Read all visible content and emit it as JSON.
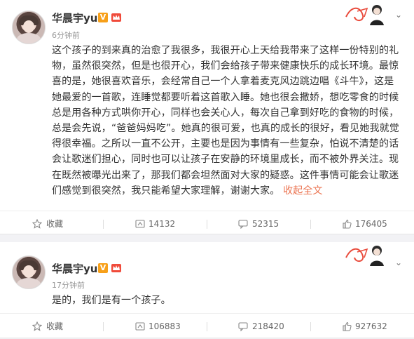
{
  "posts": [
    {
      "author": "华晨宇yu",
      "time": "6分钟前",
      "paragraph": "这个孩子的到来真的治愈了我很多，我很开心上天给我带来了这样一份特别的礼物，虽然很突然，但是也很开心，我们会给孩子带来健康快乐的成长环境。最惊喜的是，她很喜欢音乐，会经常自己一个人拿着麦克风边跳边唱《斗牛》，这是她最爱的一首歌，连睡觉都要听着这首歌入睡。她也很会撒娇，想吃零食的时候总是用各种方式哄你开心，同样也会关心人，每次自己拿到好吃的食物的时候，总是会先说，“爸爸妈妈吃”。她真的很可爱，也真的成长的很好，看见她我就觉得很幸福。之所以一直不公开，主要也是因为事情有一些复杂，怕说不清楚的话会让歌迷们担心，同时也可以让孩子在安静的环境里成长，而不被外界关注。现在既然被曝光出来了，那我们都会坦然面对大家的疑惑。这件事情可能会让歌迷们感觉到很突然，我只能希望大家理解，谢谢大家。",
      "collapse": "收起全文",
      "collect": "收藏",
      "repost": "14132",
      "comment": "52315",
      "like": "176405"
    },
    {
      "author": "华晨宇yu",
      "time": "17分钟前",
      "paragraph": "是的，我们是有一个孩子。",
      "collect": "收藏",
      "repost": "106883",
      "comment": "218420",
      "like": "927632"
    }
  ],
  "colors": {
    "accent": "#eb7350",
    "badge": "#f7a01a",
    "crown": "#f04a3a"
  },
  "icons": [
    "chevron-down-icon",
    "star-icon",
    "repost-icon",
    "comment-icon",
    "like-icon",
    "vip-icon",
    "crown-icon"
  ]
}
